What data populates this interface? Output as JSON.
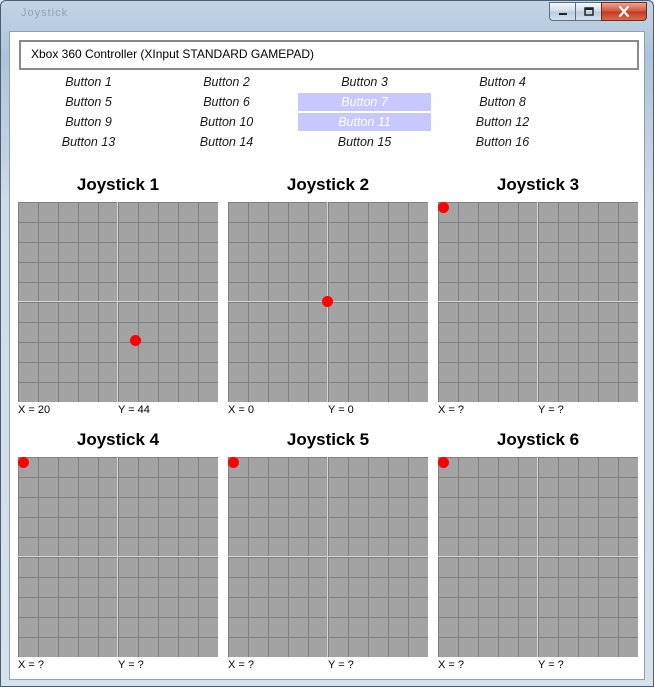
{
  "window": {
    "title": "Joystick",
    "controls": {
      "minimize": "minimize-icon",
      "maximize": "maximize-icon",
      "close": "close-icon"
    }
  },
  "device": {
    "name": "Xbox 360 Controller (XInput STANDARD GAMEPAD)"
  },
  "buttons": [
    {
      "label": "Button 1",
      "pressed": false
    },
    {
      "label": "Button 2",
      "pressed": false
    },
    {
      "label": "Button 3",
      "pressed": false
    },
    {
      "label": "Button 4",
      "pressed": false
    },
    {
      "label": "Button 5",
      "pressed": false
    },
    {
      "label": "Button 6",
      "pressed": false
    },
    {
      "label": "Button 7",
      "pressed": true
    },
    {
      "label": "Button 8",
      "pressed": false
    },
    {
      "label": "Button 9",
      "pressed": false
    },
    {
      "label": "Button 10",
      "pressed": false
    },
    {
      "label": "Button 11",
      "pressed": true
    },
    {
      "label": "Button 12",
      "pressed": false
    },
    {
      "label": "Button 13",
      "pressed": false
    },
    {
      "label": "Button 14",
      "pressed": false
    },
    {
      "label": "Button 15",
      "pressed": false
    },
    {
      "label": "Button 16",
      "pressed": false
    }
  ],
  "joysticks": [
    {
      "title": "Joystick 1",
      "x_text": "X = 20",
      "y_text": "Y = 44",
      "x": 20,
      "y": 44,
      "active": true
    },
    {
      "title": "Joystick 2",
      "x_text": "X = 0",
      "y_text": "Y = 0",
      "x": 0,
      "y": 0,
      "active": true
    },
    {
      "title": "Joystick 3",
      "x_text": "X = ?",
      "y_text": "Y = ?",
      "x": null,
      "y": null,
      "active": false
    },
    {
      "title": "Joystick 4",
      "x_text": "X = ?",
      "y_text": "Y = ?",
      "x": null,
      "y": null,
      "active": false
    },
    {
      "title": "Joystick 5",
      "x_text": "X = ?",
      "y_text": "Y = ?",
      "x": null,
      "y": null,
      "active": false
    },
    {
      "title": "Joystick 6",
      "x_text": "X = ?",
      "y_text": "Y = ?",
      "x": null,
      "y": null,
      "active": false
    }
  ],
  "colors": {
    "pressed_bg": "#c9c7ff",
    "dot": "#ff0000",
    "grid_bg": "#a3a3a3"
  }
}
